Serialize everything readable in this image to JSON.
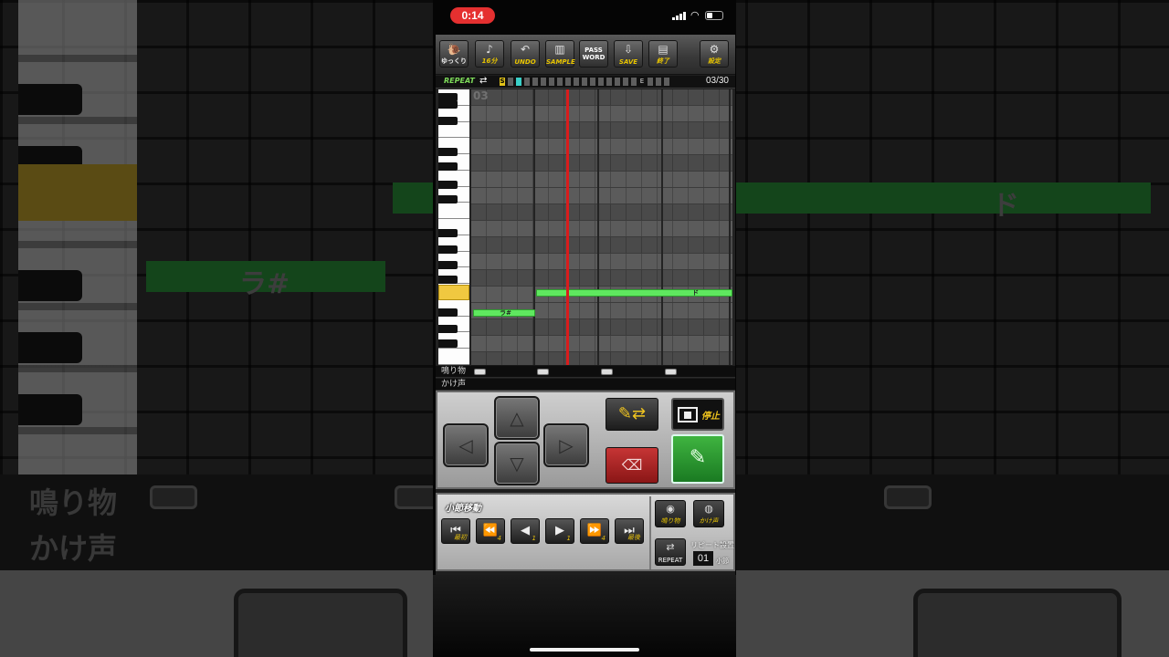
{
  "status_bar": {
    "time": "0:14",
    "wifi_icon": "wifi-icon",
    "signal_icon": "signal-icon",
    "battery_icon": "battery-icon",
    "recording_color": "#e53030"
  },
  "toolbar": {
    "buttons": [
      {
        "id": "slow",
        "label": "ゆっくり",
        "icon": "snail-icon"
      },
      {
        "id": "note-length",
        "label": "16分",
        "icon": "note-icon"
      },
      {
        "id": "undo",
        "label": "UNDO",
        "icon": "undo-icon"
      },
      {
        "id": "sample",
        "label": "SAMPLE",
        "icon": "piano-icon"
      },
      {
        "id": "password",
        "label": "PASS WORD",
        "icon": "password-icon"
      },
      {
        "id": "save",
        "label": "SAVE",
        "icon": "save-icon"
      },
      {
        "id": "exit",
        "label": "終了",
        "icon": "exit-icon"
      },
      {
        "id": "settings",
        "label": "設定",
        "icon": "gear-icon"
      }
    ]
  },
  "repeat_bar": {
    "label": "REPEAT",
    "start_marker": "S",
    "end_marker": "E",
    "counter": "03/30",
    "current_measure": 3,
    "total_measures": 30
  },
  "piano_roll": {
    "measure_number": "03",
    "highlighted_key_color": "#f0c840",
    "note_color": "#5fe85f",
    "playhead_color": "#d91c1c",
    "notes": [
      {
        "label": "ラ#"
      },
      {
        "label": "ド"
      }
    ]
  },
  "drum_rows": {
    "percussion_label": "鳴り物",
    "voice_label": "かけ声"
  },
  "controls": {
    "stop_label": "停止",
    "mode_icon": "pencil-swap-icon",
    "eraser_icon": "eraser-icon",
    "pen_icon": "pen-icon"
  },
  "measure_move": {
    "title": "小節移動",
    "buttons": [
      {
        "id": "first",
        "icon": "skip-first-icon",
        "num": "最初"
      },
      {
        "id": "back-4",
        "icon": "rewind-icon",
        "num": "4"
      },
      {
        "id": "back-1",
        "icon": "prev-icon",
        "num": "1"
      },
      {
        "id": "fwd-1",
        "icon": "next-icon",
        "num": "1"
      },
      {
        "id": "fwd-4",
        "icon": "fast-forward-icon",
        "num": "4"
      },
      {
        "id": "last",
        "icon": "skip-last-icon",
        "num": "最後"
      }
    ],
    "percussion_btn": "鳴り物",
    "voice_btn": "かけ声",
    "repeat_btn": "REPEAT",
    "repeat_setting_label": "リピート設置",
    "repeat_count": "01",
    "repeat_unit": "小節"
  },
  "background_zoom": {
    "note_left_label": "ラ#",
    "note_right_label": "ド",
    "row_label_1": "鳴り物",
    "row_label_2": "かけ声",
    "stop_label": "停止"
  }
}
